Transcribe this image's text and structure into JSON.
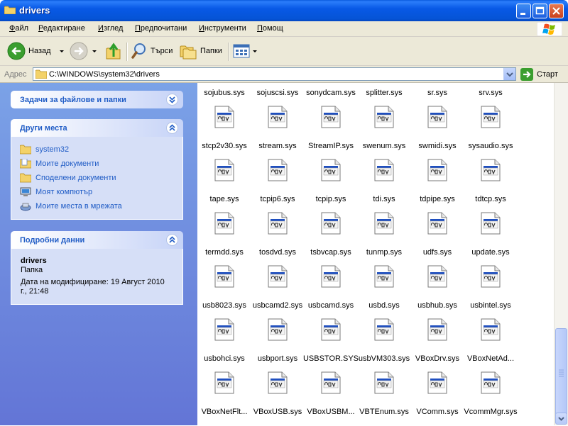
{
  "window": {
    "title": "drivers"
  },
  "menu": {
    "items": [
      {
        "label": "Файл",
        "u": "Ф",
        "rest": "айл"
      },
      {
        "label": "Редактиране",
        "u": "Р",
        "rest": "едактиране"
      },
      {
        "label": "Изглед",
        "u": "И",
        "rest": "зглед"
      },
      {
        "label": "Предпочитани",
        "u": "П",
        "rest": "редпочитани"
      },
      {
        "label": "Инструменти",
        "u": "И",
        "rest": "нструменти"
      },
      {
        "label": "Помощ",
        "u": "П",
        "rest": "омощ"
      }
    ]
  },
  "toolbar": {
    "back_label": "Назад",
    "search_label": "Търси",
    "folders_label": "Папки"
  },
  "address": {
    "label": "Адрес",
    "value": "C:\\WINDOWS\\system32\\drivers",
    "go_label": "Старт"
  },
  "tasks_panel": {
    "title": "Задачи за файлове и папки"
  },
  "places_panel": {
    "title": "Други места",
    "links": [
      {
        "label": "system32",
        "icon": "folder-icon"
      },
      {
        "label": "Моите документи",
        "icon": "my-documents-icon"
      },
      {
        "label": "Споделени документи",
        "icon": "folder-icon"
      },
      {
        "label": "Моят компютър",
        "icon": "my-computer-icon"
      },
      {
        "label": "Моите места в мрежата",
        "icon": "network-places-icon"
      }
    ]
  },
  "details_panel": {
    "title": "Подробни данни",
    "name": "drivers",
    "type": "Папка",
    "modified": "Дата на модифициране: 19 Август 2010 г., 21:48"
  },
  "files": [
    [
      "sojubus.sys",
      "sojuscsi.sys",
      "sonydcam.sys",
      "splitter.sys",
      "sr.sys",
      "srv.sys"
    ],
    [
      "stcp2v30.sys",
      "stream.sys",
      "StreamIP.sys",
      "swenum.sys",
      "swmidi.sys",
      "sysaudio.sys"
    ],
    [
      "tape.sys",
      "tcpip6.sys",
      "tcpip.sys",
      "tdi.sys",
      "tdpipe.sys",
      "tdtcp.sys"
    ],
    [
      "termdd.sys",
      "tosdvd.sys",
      "tsbvcap.sys",
      "tunmp.sys",
      "udfs.sys",
      "update.sys"
    ],
    [
      "usb8023.sys",
      "usbcamd2.sys",
      "usbcamd.sys",
      "usbd.sys",
      "usbhub.sys",
      "usbintel.sys"
    ],
    [
      "usbohci.sys",
      "usbport.sys",
      "USBSTOR.SYS",
      "usbVM303.sys",
      "VBoxDrv.sys",
      "VBoxNetAd..."
    ],
    [
      "VBoxNetFlt...",
      "VBoxUSB.sys",
      "VBoxUSBM...",
      "VBTEnum.sys",
      "VComm.sys",
      "VcommMgr.sys"
    ]
  ],
  "colors": {
    "title_bar": "#0859e6",
    "left_pane": "#6d8fe0",
    "link": "#215dc6",
    "panel_body": "#d6dff7"
  }
}
